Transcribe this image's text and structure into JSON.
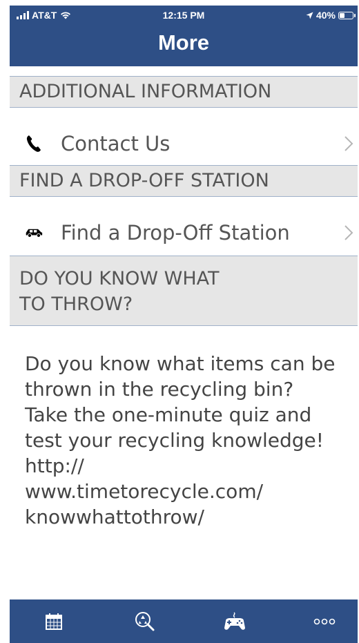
{
  "status_bar": {
    "carrier": "AT&T",
    "time": "12:15 PM",
    "battery": "40%"
  },
  "header": {
    "title": "More"
  },
  "sections": [
    {
      "header": "ADDITIONAL INFORMATION",
      "item_label": "Contact Us",
      "icon": "phone-icon"
    },
    {
      "header": "FIND A DROP-OFF STATION",
      "item_label": "Find a Drop-Off Station",
      "icon": "car-icon"
    },
    {
      "header": "DO YOU KNOW WHAT\nTO THROW?",
      "body": "Do you know what items can be thrown in the recycling bin? Take the one-minute quiz and test your recycling knowledge! http://\nwww.timetorecycle.com/\nknowwhattothrow/"
    }
  ],
  "tab_bar": {
    "tabs": [
      {
        "icon": "calendar-icon"
      },
      {
        "icon": "recycle-search-icon"
      },
      {
        "icon": "game-controller-icon"
      },
      {
        "icon": "more-dots-icon"
      }
    ]
  },
  "colors": {
    "primary": "#2e4f86",
    "section_bg": "#e6e6e6",
    "divider": "#9fb0c8",
    "text": "#555555"
  }
}
